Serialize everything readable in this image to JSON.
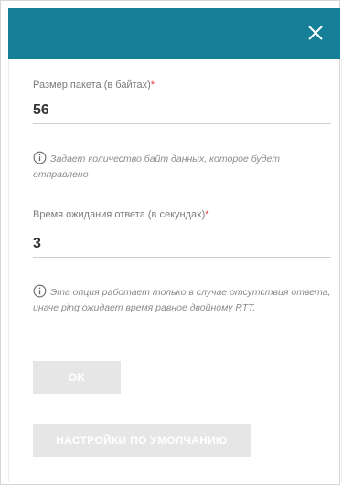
{
  "dialog": {
    "close_icon": "close-icon"
  },
  "fields": {
    "packet_size": {
      "label": "Размер пакета (в байтах)",
      "required_mark": "*",
      "value": "56",
      "hint": "Задает количество байт данных, которое будет отправлено"
    },
    "timeout": {
      "label": "Время ожидания ответа (в секундах)",
      "required_mark": "*",
      "value": "3",
      "hint": "Эта опция работает только в случае отсутствия ответа, иначе ping ожидает время равное двойному RTT."
    }
  },
  "buttons": {
    "ok_label": "OK",
    "defaults_label": "НАСТРОЙКИ ПО УМОЛЧАНИЮ"
  },
  "colors": {
    "header": "#147f96",
    "required": "#e0413b",
    "button_disabled": "#e6e6e6"
  }
}
